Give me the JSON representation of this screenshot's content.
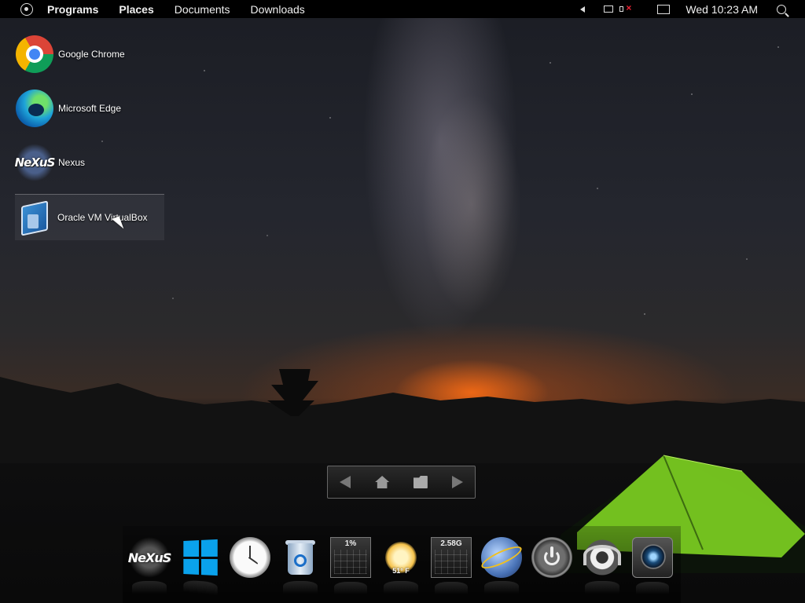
{
  "topbar": {
    "menu": [
      "Programs",
      "Places",
      "Documents",
      "Downloads"
    ],
    "clock": "Wed 10:23 AM"
  },
  "desktop": {
    "icons": [
      {
        "label": "Google Chrome",
        "icon": "chrome-icon"
      },
      {
        "label": "Microsoft Edge",
        "icon": "edge-icon"
      },
      {
        "label": "Nexus",
        "icon": "nexus-icon"
      },
      {
        "label": "Oracle VM VirtualBox",
        "icon": "virtualbox-icon"
      }
    ]
  },
  "nav_widget": {
    "icons": [
      "back-arrow-icon",
      "home-icon",
      "folder-icon",
      "forward-arrow-icon"
    ]
  },
  "dock": {
    "items": [
      {
        "name": "nexus",
        "logo_text": "NeXuS"
      },
      {
        "name": "windows"
      },
      {
        "name": "clock"
      },
      {
        "name": "recycle-bin"
      },
      {
        "name": "cpu-meter",
        "value": "1%"
      },
      {
        "name": "weather",
        "value": "51° F"
      },
      {
        "name": "memory-meter",
        "value": "2.58G"
      },
      {
        "name": "globe"
      },
      {
        "name": "power"
      },
      {
        "name": "webcam"
      },
      {
        "name": "camera"
      }
    ]
  },
  "colors": {
    "topbar_bg": "#000000",
    "windows_blue": "#0aa2ec",
    "tent_green": "#7ed321"
  }
}
